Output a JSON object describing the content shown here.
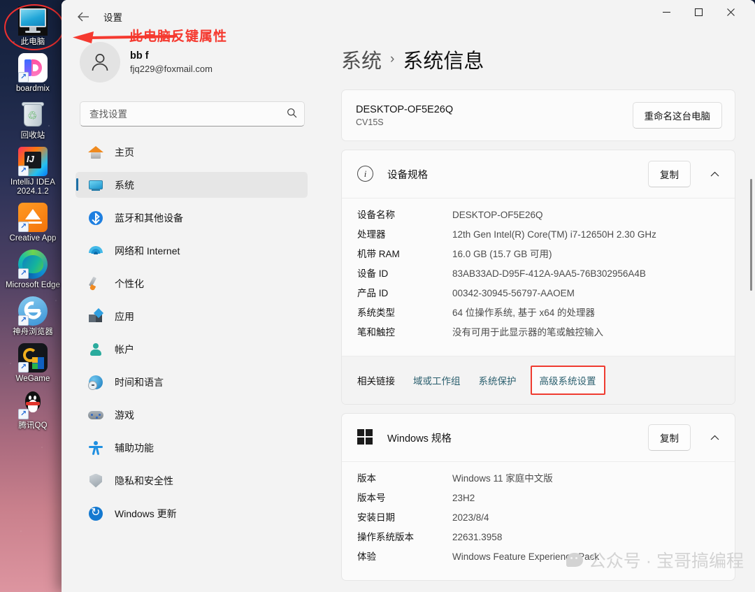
{
  "desktop": {
    "icons": [
      {
        "label": "此电脑",
        "icon": "this-pc-icon"
      },
      {
        "label": "boardmix",
        "icon": "boardmix-icon"
      },
      {
        "label": "回收站",
        "icon": "recycle-bin-icon"
      },
      {
        "label": "IntelliJ IDEA 2024.1.2",
        "icon": "intellij-idea-icon"
      },
      {
        "label": "Creative App",
        "icon": "creative-app-icon"
      },
      {
        "label": "Microsoft Edge",
        "icon": "microsoft-edge-icon"
      },
      {
        "label": "神舟浏览器",
        "icon": "hasee-browser-icon"
      },
      {
        "label": "WeGame",
        "icon": "wegame-icon"
      },
      {
        "label": "腾讯QQ",
        "icon": "tencent-qq-icon"
      }
    ],
    "annotation": {
      "text": "此电脑反键属性",
      "color": "#f5392f"
    }
  },
  "window": {
    "title": "设置",
    "back_label": "←",
    "controls": {
      "minimize": "minimize-icon",
      "maximize": "maximize-icon",
      "close": "close-icon"
    }
  },
  "sidebar": {
    "account": {
      "name": "bb f",
      "email": "fjq229@foxmail.com"
    },
    "search": {
      "placeholder": "查找设置",
      "value": ""
    },
    "items": [
      {
        "label": "主页",
        "icon": "home-icon",
        "selected": false
      },
      {
        "label": "系统",
        "icon": "system-icon",
        "selected": true
      },
      {
        "label": "蓝牙和其他设备",
        "icon": "bluetooth-icon",
        "selected": false
      },
      {
        "label": "网络和 Internet",
        "icon": "network-icon",
        "selected": false
      },
      {
        "label": "个性化",
        "icon": "personalization-icon",
        "selected": false
      },
      {
        "label": "应用",
        "icon": "apps-icon",
        "selected": false
      },
      {
        "label": "帐户",
        "icon": "accounts-icon",
        "selected": false
      },
      {
        "label": "时间和语言",
        "icon": "time-language-icon",
        "selected": false
      },
      {
        "label": "游戏",
        "icon": "gaming-icon",
        "selected": false
      },
      {
        "label": "辅助功能",
        "icon": "accessibility-icon",
        "selected": false
      },
      {
        "label": "隐私和安全性",
        "icon": "privacy-security-icon",
        "selected": false
      },
      {
        "label": "Windows 更新",
        "icon": "windows-update-icon",
        "selected": false
      }
    ]
  },
  "main": {
    "breadcrumb": {
      "parent": "系统",
      "separator": "›",
      "current": "系统信息"
    },
    "device_card": {
      "name": "DESKTOP-OF5E26Q",
      "model": "CV15S",
      "rename_button": "重命名这台电脑"
    },
    "device_specs": {
      "title": "设备规格",
      "icon": "info-icon",
      "copy_button": "复制",
      "collapse_icon": "chevron-up-icon",
      "rows": [
        {
          "key": "设备名称",
          "value": "DESKTOP-OF5E26Q"
        },
        {
          "key": "处理器",
          "value": "12th Gen Intel(R) Core(TM) i7-12650H   2.30 GHz"
        },
        {
          "key": "机带 RAM",
          "value": "16.0 GB (15.7 GB 可用)"
        },
        {
          "key": "设备 ID",
          "value": "83AB33AD-D95F-412A-9AA5-76B302956A4B"
        },
        {
          "key": "产品 ID",
          "value": "00342-30945-56797-AAOEM"
        },
        {
          "key": "系统类型",
          "value": "64 位操作系统, 基于 x64 的处理器"
        },
        {
          "key": "笔和触控",
          "value": "没有可用于此显示器的笔或触控输入"
        }
      ],
      "links_title": "相关链接",
      "links": [
        {
          "label": "域或工作组",
          "highlighted": false
        },
        {
          "label": "系统保护",
          "highlighted": false
        },
        {
          "label": "高级系统设置",
          "highlighted": true
        }
      ]
    },
    "windows_specs": {
      "title": "Windows 规格",
      "icon": "windows-logo-icon",
      "copy_button": "复制",
      "collapse_icon": "chevron-up-icon",
      "rows": [
        {
          "key": "版本",
          "value": "Windows 11 家庭中文版"
        },
        {
          "key": "版本号",
          "value": "23H2"
        },
        {
          "key": "安装日期",
          "value": "2023/8/4"
        },
        {
          "key": "操作系统版本",
          "value": "22631.3958"
        },
        {
          "key": "体验",
          "value": "Windows Feature Experience Pack"
        }
      ]
    }
  },
  "watermark": {
    "text": "公众号 · 宝哥搞编程"
  }
}
